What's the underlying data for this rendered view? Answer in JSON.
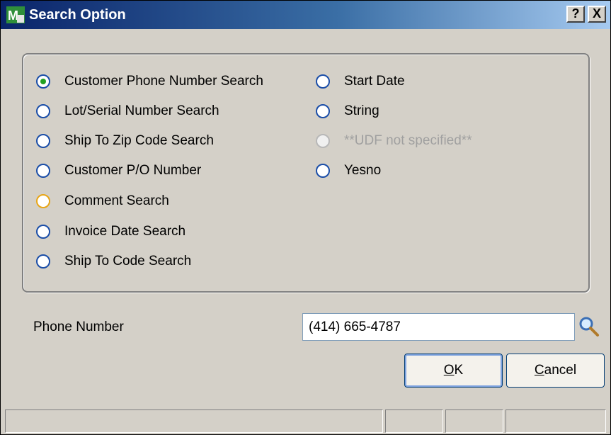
{
  "window": {
    "title": "Search Option",
    "help_label": "?",
    "close_label": "X"
  },
  "options_left": [
    {
      "label": "Customer Phone Number Search",
      "checked": true,
      "state": "checked"
    },
    {
      "label": "Lot/Serial Number Search",
      "checked": false,
      "state": "normal"
    },
    {
      "label": "Ship To Zip Code Search",
      "checked": false,
      "state": "normal"
    },
    {
      "label": "Customer P/O Number",
      "checked": false,
      "state": "normal"
    },
    {
      "label": "Comment Search",
      "checked": false,
      "state": "focused"
    },
    {
      "label": "Invoice Date Search",
      "checked": false,
      "state": "normal"
    },
    {
      "label": "Ship To Code Search",
      "checked": false,
      "state": "normal"
    }
  ],
  "options_right": [
    {
      "label": "Start Date",
      "checked": false,
      "state": "normal"
    },
    {
      "label": "String",
      "checked": false,
      "state": "normal"
    },
    {
      "label": "**UDF not specified**",
      "checked": false,
      "state": "disabled"
    },
    {
      "label": "Yesno",
      "checked": false,
      "state": "normal"
    }
  ],
  "search_field": {
    "label": "Phone Number",
    "value": "(414) 665-4787",
    "lookup_icon": "magnifier-icon"
  },
  "buttons": {
    "ok": "OK",
    "ok_mnemonic": "O",
    "cancel": "Cancel",
    "cancel_mnemonic": "C"
  },
  "colors": {
    "title_gradient_start": "#0a246a",
    "title_gradient_end": "#a6caf0",
    "dialog_bg": "#d4d0c8",
    "radio_border": "#1b4ea8",
    "radio_checked_dot": "#21a121",
    "radio_focus": "#e8a617"
  }
}
